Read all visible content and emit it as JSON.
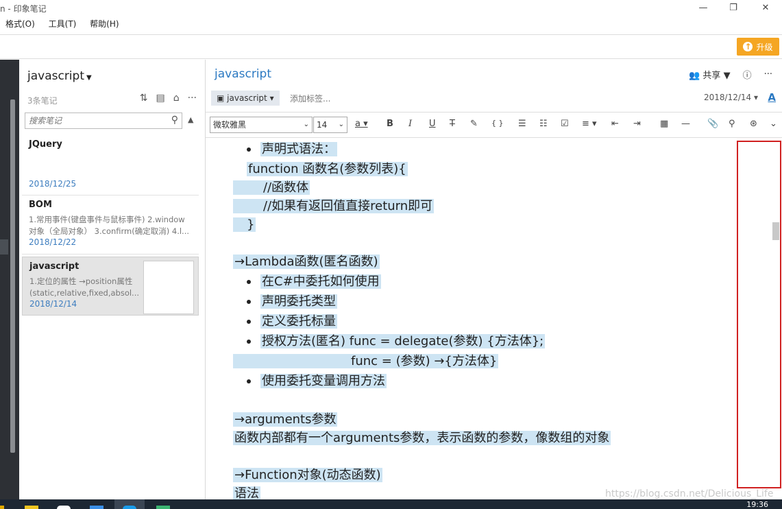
{
  "window": {
    "title": "n - 印象笔记",
    "min_icon": "minimize-icon",
    "restore_icon": "restore-icon",
    "close_icon": "close-icon"
  },
  "menu": [
    "格式(O)",
    "工具(T)",
    "帮助(H)"
  ],
  "upgrade": {
    "label": "升级",
    "color": "#f5a623"
  },
  "notelist": {
    "title": "javascript",
    "count": "3条笔记",
    "search_placeholder": "搜索笔记",
    "notes": [
      {
        "title": "JQuery",
        "preview": "",
        "date": "2018/12/25"
      },
      {
        "title": "BOM",
        "preview": "1.常用事件(键盘事件与鼠标事件) 2.window 对象（全局对象） 3.confirm(确定取消) 4.l...",
        "date": "2018/12/22"
      },
      {
        "title": "javascript",
        "preview": "1.定位的属性 →position属性 (static,relative,fixed,absol...",
        "date": "2018/12/14"
      }
    ]
  },
  "editor": {
    "title": "javascript",
    "share_label": "共享",
    "notebook": "javascript",
    "add_tag": "添加标签...",
    "date": "2018/12/14",
    "font": "微软雅黑",
    "size": "14",
    "lines": [
      "声明式语法：",
      "function 函数名(参数列表){",
      "//函数体",
      "//如果有返回值直接return即可",
      "}",
      "→Lambda函数(匿名函数)",
      "在C#中委托如何使用",
      "声明委托类型",
      "定义委托标量",
      "授权方法(匿名) func = delegate(参数) {方法体};",
      "func = (参数) →{方法体}",
      "使用委托变量调用方法",
      "→arguments参数",
      "函数内部都有一个arguments参数，表示函数的参数，像数组的对象",
      "→Function对象(动态函数)",
      "语法"
    ]
  },
  "watermark": "https://blog.csdn.net/Delicious_Life",
  "clock": "19:36",
  "accent": "#2b79c2",
  "highlight": "#cde4f3"
}
